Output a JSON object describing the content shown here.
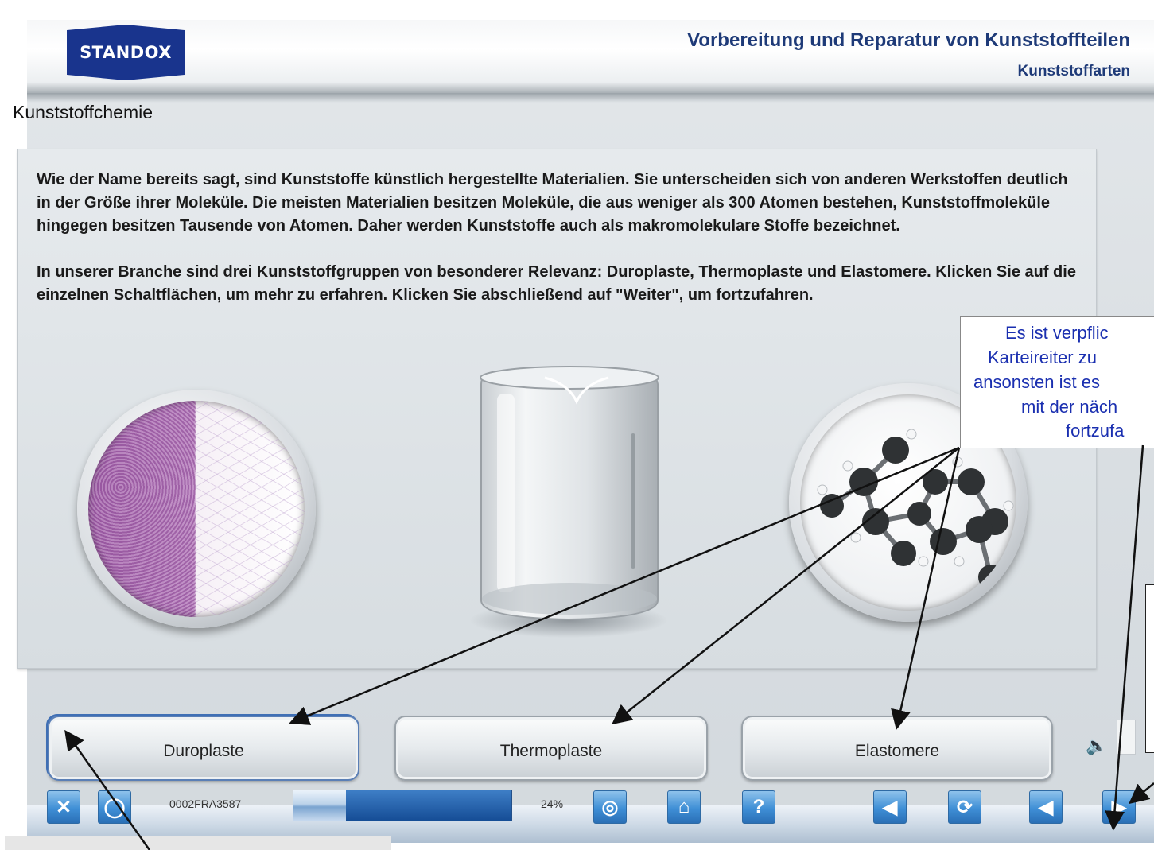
{
  "header": {
    "logo": "STANDOX",
    "course_title": "Vorbereitung und Reparatur von Kunststoffteilen",
    "section_title": "Kunststoffarten"
  },
  "page": {
    "title": "Kunststoffchemie",
    "paragraph_1": "Wie der Name bereits sagt, sind Kunststoffe künstlich hergestellte Materialien. Sie unterscheiden sich von anderen Werkstoffen deutlich in der Größe ihrer Moleküle. Die meisten Materialien besitzen Moleküle, die aus weniger als 300 Atomen bestehen, Kunststoffmoleküle hingegen besitzen Tausende von Atomen. Daher werden Kunststoffe auch als makromolekulare Stoffe bezeichnet.",
    "paragraph_2": "In unserer Branche sind drei Kunststoffgruppen von besonderer Relevanz: Duroplaste, Thermoplaste und Elastomere. Klicken Sie auf die einzelnen Schaltflächen, um mehr zu erfahren. Klicken Sie abschließend auf \"Weiter\", um fortzufahren."
  },
  "tabs": [
    {
      "label": "Duroplaste"
    },
    {
      "label": "Thermoplaste"
    },
    {
      "label": "Elastomere"
    }
  ],
  "toolbar": {
    "course_code": "0002FRA3587",
    "progress_percent": "24%",
    "progress_value": 0.24,
    "accent_color": "#3f8fd6"
  },
  "annotation": {
    "lines": [
      "Es ist verpflic",
      "Karteireiter zu",
      "ansonsten ist es",
      "mit der näch",
      "fortzufa"
    ],
    "text_color": "#1a2fb0"
  },
  "icons": {
    "close": "close-icon",
    "settings": "settings-icon",
    "globe": "globe-icon",
    "home": "home-icon",
    "help": "help-icon",
    "audio": "speaker-icon",
    "replay": "replay-icon",
    "back": "back-arrow-icon",
    "next": "next-arrow-icon"
  }
}
